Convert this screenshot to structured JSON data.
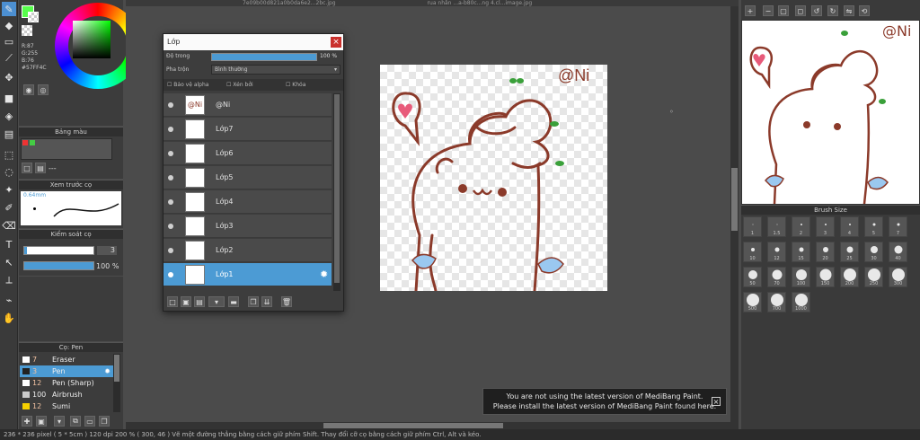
{
  "colors": {
    "accent": "#4c9bd4",
    "primary_color": "#57ff4c",
    "canvas_stroke": "#8b3a2a"
  },
  "color_panel": {
    "rgb_r": "R:87",
    "rgb_g": "G:255",
    "rgb_b": "B:76",
    "hex": "#57FF4C"
  },
  "palette_panel": {
    "title": "Bảng màu",
    "list_value": "---"
  },
  "brush_preview": {
    "title": "Xem trước cọ",
    "size_label": "0.64mm"
  },
  "brush_control": {
    "title": "Kiểm soát cọ",
    "size_value": "3",
    "opacity_value": "100 %"
  },
  "brush_list": {
    "title": "Cọ: Pen",
    "items": [
      {
        "size": "7",
        "name": "Eraser",
        "color": "#ffffff"
      },
      {
        "size": "3",
        "name": "Pen",
        "color": "#ffffff"
      },
      {
        "size": "12",
        "name": "Pen (Sharp)",
        "color": "#ffffff"
      },
      {
        "size": "100",
        "name": "Airbrush",
        "color": "#cccccc"
      },
      {
        "size": "12",
        "name": "Sumi",
        "color": "#f5d000"
      }
    ]
  },
  "tabs": {
    "tab1": "7e09b00d821a0b0da6e2...2bc.jpg",
    "tab2": "rua nhân ...a-b80c...ng 4.cl...image.jpg"
  },
  "layer_window": {
    "title": "Lớp",
    "opacity_label": "Độ trong",
    "opacity_value": "100 %",
    "blend_label": "Pha trộn",
    "blend_value": "Bình thường",
    "protect_alpha": "Bảo vệ alpha",
    "clipping": "Xén bởi",
    "lock": "Khóa",
    "layers": [
      {
        "name": "@Ni",
        "thumb": "@Ni"
      },
      {
        "name": "Lớp7",
        "thumb": ""
      },
      {
        "name": "Lớp6",
        "thumb": ""
      },
      {
        "name": "Lớp5",
        "thumb": ""
      },
      {
        "name": "Lớp4",
        "thumb": ""
      },
      {
        "name": "Lớp3",
        "thumb": ""
      },
      {
        "name": "Lớp2",
        "thumb": ""
      },
      {
        "name": "Lớp1",
        "thumb": ""
      }
    ]
  },
  "canvas": {
    "watermark": "@Ni"
  },
  "navigator": {
    "watermark": "@Ni"
  },
  "brush_size": {
    "title": "Brush Size",
    "sizes": [
      "1",
      "1.5",
      "2",
      "3",
      "4",
      "5",
      "7",
      "10",
      "12",
      "15",
      "20",
      "25",
      "30",
      "40",
      "50",
      "70",
      "100",
      "150",
      "200",
      "250",
      "300",
      "500",
      "700",
      "1000"
    ]
  },
  "toast": {
    "line1": "You are not using the latest version of MediBang Paint.",
    "line2": "Please install the latest version of MediBang Paint found here."
  },
  "status": "236 * 236 pixel  ( 5 * 5cm )  120 dpi   200 %  ( 300, 46 )  Vẽ một đường thẳng bằng cách giữ phím Shift. Thay đổi cỡ cọ bằng cách giữ phím Ctrl, Alt và kéo."
}
